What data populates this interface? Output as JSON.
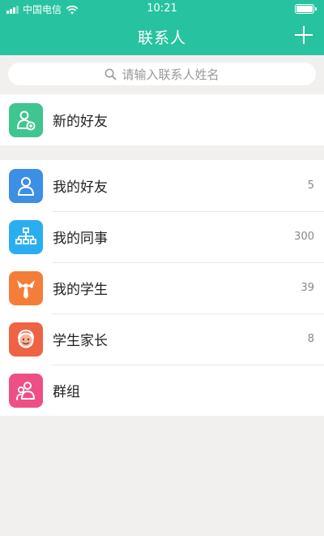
{
  "status_bar": {
    "carrier": "中国电信",
    "time": "10:21"
  },
  "nav": {
    "title": "联系人",
    "add_icon": "plus-icon"
  },
  "search": {
    "placeholder": "请输入联系人姓名"
  },
  "new_friend": {
    "label": "新的好友",
    "icon": "add-contact-icon",
    "color": "#3fc58f"
  },
  "groups": [
    {
      "label": "我的好友",
      "count": "5",
      "icon": "person-icon",
      "color": "#3d8fe5"
    },
    {
      "label": "我的同事",
      "count": "300",
      "icon": "org-chart-icon",
      "color": "#2aaef0"
    },
    {
      "label": "我的学生",
      "count": "39",
      "icon": "student-icon",
      "color": "#f47e39"
    },
    {
      "label": "学生家长",
      "count": "8",
      "icon": "parent-face-icon",
      "color": "#ef6345"
    },
    {
      "label": "群组",
      "count": "",
      "icon": "group-icon",
      "color": "#ee4f85"
    }
  ],
  "colors": {
    "brand": "#27c3a0",
    "background": "#f1f0ef"
  }
}
